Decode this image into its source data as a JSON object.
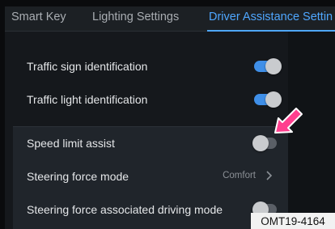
{
  "tabs": [
    {
      "label": "Smart Key",
      "active": false
    },
    {
      "label": "Lighting Settings",
      "active": false
    },
    {
      "label": "Driver Assistance Settin",
      "active": true
    }
  ],
  "settings": [
    {
      "label": "Traffic sign identification",
      "type": "toggle",
      "state": "on"
    },
    {
      "label": "Traffic light identification",
      "type": "toggle",
      "state": "on"
    },
    {
      "label": "Speed limit assist",
      "type": "toggle",
      "state": "off"
    },
    {
      "label": "Steering force mode",
      "type": "select",
      "value": "Comfort"
    },
    {
      "label": "Steering force associated driving mode",
      "type": "toggle",
      "state": "off"
    }
  ],
  "callout": {
    "icon": "pink-arrow-pointer-icon",
    "color": "#ff3f8e"
  },
  "reference_code": "OMT19-4164",
  "colors": {
    "accent": "#4fa7ff",
    "toggle_on": "#3f8fe8"
  }
}
